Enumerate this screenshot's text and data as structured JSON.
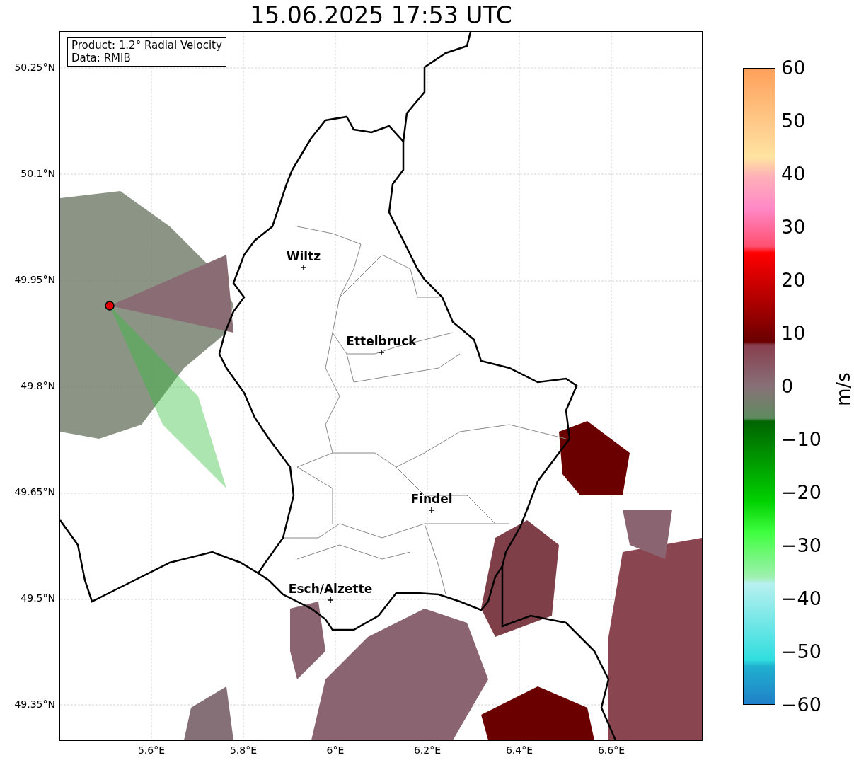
{
  "title": "15.06.2025 17:53 UTC",
  "map": {
    "info_box": [
      "Product: 1.2° Radial Velocity",
      "Data: RMIB"
    ],
    "cities": [
      {
        "name": "Wiltz"
      },
      {
        "name": "Ettelbruck"
      },
      {
        "name": "Findel"
      },
      {
        "name": "Esch/Alzette"
      }
    ],
    "xticks": [
      "5.6°E",
      "5.8°E",
      "6°E",
      "6.2°E",
      "6.4°E",
      "6.6°E"
    ],
    "yticks": [
      "50.25°N",
      "50.1°N",
      "49.95°N",
      "49.8°N",
      "49.65°N",
      "49.5°N",
      "49.35°N"
    ]
  },
  "colorbar": {
    "label": "m/s",
    "ticks": [
      "60",
      "50",
      "40",
      "30",
      "20",
      "10",
      "0",
      "−10",
      "−20",
      "−30",
      "−40",
      "−50",
      "−60"
    ]
  }
}
